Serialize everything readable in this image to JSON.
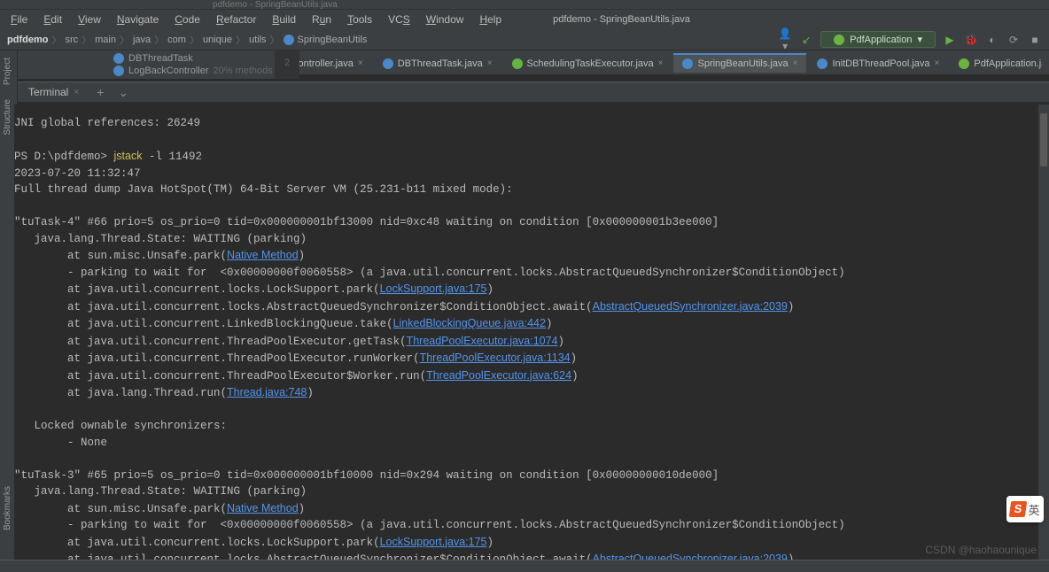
{
  "window_title": "pdfdemo - SpringBeanUtils.java",
  "menu": [
    "File",
    "Edit",
    "View",
    "Navigate",
    "Code",
    "Refactor",
    "Build",
    "Run",
    "Tools",
    "VCS",
    "Window",
    "Help"
  ],
  "breadcrumbs": [
    "pdfdemo",
    "src",
    "main",
    "java",
    "com",
    "unique",
    "utils",
    "SpringBeanUtils"
  ],
  "run_config": "PdfApplication",
  "project_label": "Project",
  "project_tree": [
    {
      "name": "DBThreadTask"
    },
    {
      "name": "LogBackController",
      "meta": "20% methods"
    }
  ],
  "gutter_line": "2",
  "tabs": [
    {
      "label": "LogBackController.java",
      "icon": "blue",
      "active": false
    },
    {
      "label": "DBThreadTask.java",
      "icon": "blue",
      "active": false
    },
    {
      "label": "SchedulingTaskExecutor.java",
      "icon": "green",
      "active": false
    },
    {
      "label": "SpringBeanUtils.java",
      "icon": "blue",
      "active": true
    },
    {
      "label": "InitDBThreadPool.java",
      "icon": "blue",
      "active": false
    },
    {
      "label": "PdfApplication.java",
      "icon": "spring",
      "active": false
    }
  ],
  "terminal_tab": "Terminal",
  "sidebar_labels": [
    "Project",
    "Structure",
    "Bookmarks"
  ],
  "terminal": {
    "jni": "JNI global references: 26249",
    "prompt": "PS D:\\pdfdemo> ",
    "cmd": "jstack",
    "flag": " -l ",
    "pid": "11492",
    "ts": "2023-07-20 11:32:47",
    "full": "Full thread dump Java HotSpot(TM) 64-Bit Server VM (25.231-b11 mixed mode):",
    "t4_hdr": "\"tuTask-4\" #66 prio=5 os_prio=0 tid=0x000000001bf13000 nid=0xc48 waiting on condition [0x000000001b3ee000]",
    "state": "   java.lang.Thread.State: WAITING (parking)",
    "unsafe_pre": "        at sun.misc.Unsafe.park(",
    "native": "Native Method",
    "parking": "        - parking to wait for  <0x00000000f0060558> (a java.util.concurrent.locks.AbstractQueuedSynchronizer$ConditionObject)",
    "ls_pre": "        at java.util.concurrent.locks.LockSupport.park(",
    "ls_link": "LockSupport.java:175",
    "aqs_pre": "        at java.util.concurrent.locks.AbstractQueuedSynchronizer$ConditionObject.await(",
    "aqs_link": "AbstractQueuedSynchronizer.java:2039",
    "lbq_pre": "        at java.util.concurrent.LinkedBlockingQueue.take(",
    "lbq_link": "LinkedBlockingQueue.java:442",
    "tpe1_pre": "        at java.util.concurrent.ThreadPoolExecutor.getTask(",
    "tpe1_link": "ThreadPoolExecutor.java:1074",
    "tpe2_pre": "        at java.util.concurrent.ThreadPoolExecutor.runWorker(",
    "tpe2_link": "ThreadPoolExecutor.java:1134",
    "tpe3_pre": "        at java.util.concurrent.ThreadPoolExecutor$Worker.run(",
    "tpe3_link": "ThreadPoolExecutor.java:624",
    "thr_pre": "        at java.lang.Thread.run(",
    "thr_link": "Thread.java:748",
    "locked": "   Locked ownable synchronizers:",
    "none": "        - None",
    "t3_hdr": "\"tuTask-3\" #65 prio=5 os_prio=0 tid=0x000000001bf10000 nid=0x294 waiting on condition [0x00000000010de000]"
  },
  "watermark": "CSDN @haohaounique",
  "ime": {
    "s": "S",
    "t": "英"
  }
}
